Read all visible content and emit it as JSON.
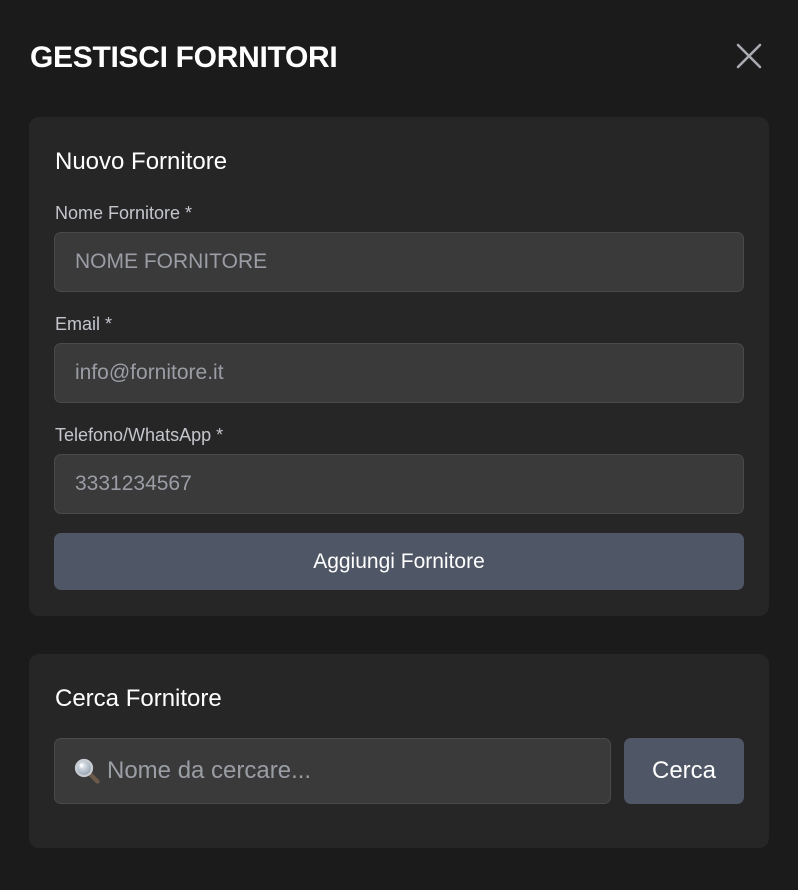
{
  "modal": {
    "title": "GESTISCI FORNITORI",
    "close_icon": "close-icon"
  },
  "new_supplier": {
    "title": "Nuovo Fornitore",
    "name_label": "Nome Fornitore *",
    "name_placeholder": "NOME FORNITORE",
    "email_label": "Email *",
    "email_placeholder": "info@fornitore.it",
    "phone_label": "Telefono/WhatsApp *",
    "phone_placeholder": "3331234567",
    "add_button_label": "Aggiungi Fornitore"
  },
  "search_supplier": {
    "title": "Cerca Fornitore",
    "search_icon": "search-icon",
    "search_placeholder": "Nome da cercare...",
    "search_button_label": "Cerca"
  },
  "colors": {
    "background": "#1b1b1c",
    "card": "#262627",
    "input": "#3a3a3b",
    "button": "#4f5665"
  }
}
